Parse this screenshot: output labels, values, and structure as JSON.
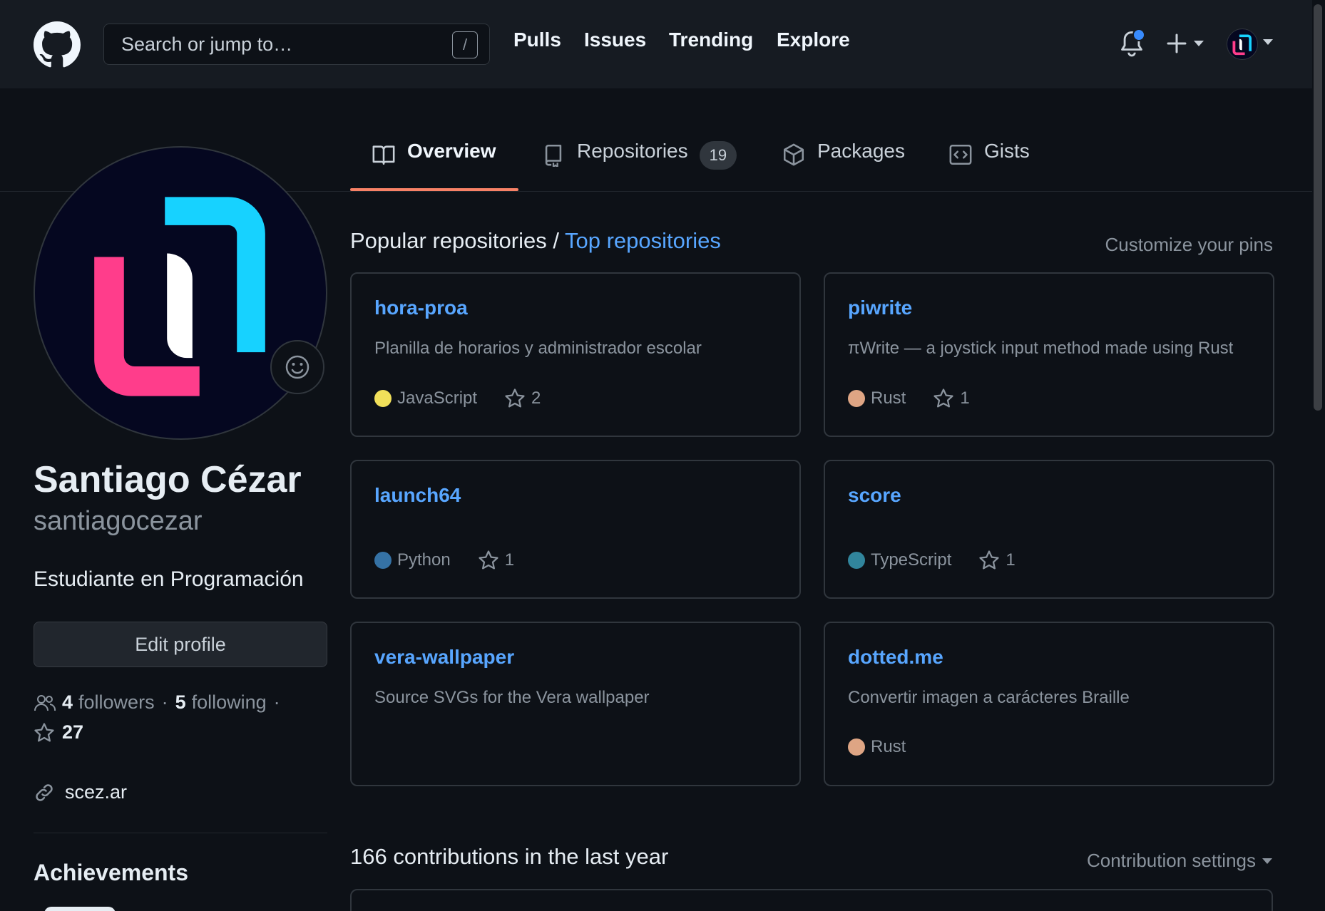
{
  "header": {
    "search_placeholder": "Search or jump to…",
    "search_shortcut": "/",
    "nav": [
      "Pulls",
      "Issues",
      "Trending",
      "Explore"
    ]
  },
  "tabs": [
    {
      "label": "Overview",
      "icon": "book-icon",
      "active": true
    },
    {
      "label": "Repositories",
      "icon": "repo-icon",
      "count": "19"
    },
    {
      "label": "Packages",
      "icon": "package-icon"
    },
    {
      "label": "Gists",
      "icon": "code-square-icon"
    }
  ],
  "profile": {
    "name": "Santiago Cézar",
    "login": "santiagocezar",
    "bio": "Estudiante en Programación",
    "edit_label": "Edit profile",
    "followers_count": "4",
    "followers_label": "followers",
    "following_count": "5",
    "following_label": "following",
    "stars": "27",
    "website": "scez.ar",
    "achievements_title": "Achievements"
  },
  "pinned": {
    "title": "Popular repositories",
    "separator": " / ",
    "title_link": "Top repositories",
    "customize": "Customize your pins",
    "repos": [
      {
        "name": "hora-proa",
        "description": "Planilla de horarios y administrador escolar",
        "language": "JavaScript",
        "lang_color": "#f1e05a",
        "stars": "2"
      },
      {
        "name": "piwrite",
        "description": "πWrite — a joystick input method made using Rust",
        "language": "Rust",
        "lang_color": "#dea584",
        "stars": "1"
      },
      {
        "name": "launch64",
        "description": "",
        "language": "Python",
        "lang_color": "#3572A5",
        "stars": "1"
      },
      {
        "name": "score",
        "description": "",
        "language": "TypeScript",
        "lang_color": "#31859c",
        "stars": "1"
      },
      {
        "name": "vera-wallpaper",
        "description": "Source SVGs for the Vera wallpaper",
        "language": "",
        "lang_color": "",
        "stars": ""
      },
      {
        "name": "dotted.me",
        "description": "Convertir imagen a carácteres Braille",
        "language": "Rust",
        "lang_color": "#dea584",
        "stars": ""
      }
    ]
  },
  "contributions": {
    "title": "166 contributions in the last year",
    "settings_label": "Contribution settings"
  },
  "colors": {
    "accent": "#58a6ff",
    "tab_underline": "#f78166",
    "avatar_cyan": "#17d2ff",
    "avatar_pink": "#ff3d8b",
    "avatar_bg": "#050720"
  }
}
